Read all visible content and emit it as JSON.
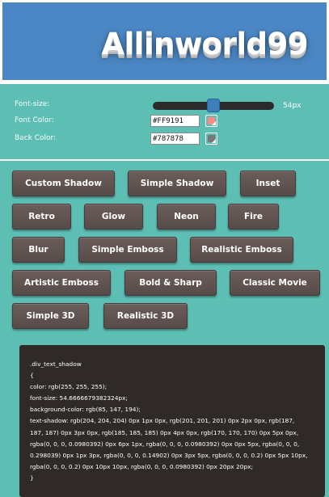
{
  "banner": {
    "title": "Allinworld99"
  },
  "controls": {
    "font_size_label": "Font-size:",
    "font_size_value": "54px",
    "font_size": 54,
    "font_color_label": "Font Color:",
    "font_color_value": "#FF9191",
    "back_color_label": "Back Color:",
    "back_color_value": "#787878",
    "font_color_swatch": "#ff8a8a",
    "back_color_swatch": "#787878"
  },
  "effects": [
    "Custom Shadow",
    "Simple Shadow",
    "Inset",
    "Retro",
    "Glow",
    "Neon",
    "Fire",
    "Blur",
    "Simple Emboss",
    "Realistic Emboss",
    "Artistic Emboss",
    "Bold & Sharp",
    "Classic Movie",
    "Simple 3D",
    "Realistic 3D"
  ],
  "css_output": [
    ".div_text_shadow",
    "{",
    "color: rgb(255, 255, 255);",
    "font-size: 54.6666679382324px;",
    "background-color: rgb(85, 147, 194);",
    "text-shadow: rgb(204, 204, 204) 0px 1px 0px, rgb(201, 201, 201) 0px 2px 0px, rgb(187,",
    "187, 187) 0px 3px 0px, rgb(185, 185, 185) 0px 4px 0px, rgb(170, 170, 170) 0px 5px 0px,",
    "rgba(0, 0, 0, 0.0980392) 0px 6px 1px, rgba(0, 0, 0, 0.0980392) 0px 0px 5px, rgba(0, 0, 0,",
    "0.298039) 0px 1px 3px, rgba(0, 0, 0, 0.14902) 0px 3px 5px, rgba(0, 0, 0, 0.2) 0px 5px 10px,",
    "rgba(0, 0, 0, 0.2) 0px 10px 10px, rgba(0, 0, 0, 0.0980392) 0px 20px 20px;",
    "}"
  ]
}
